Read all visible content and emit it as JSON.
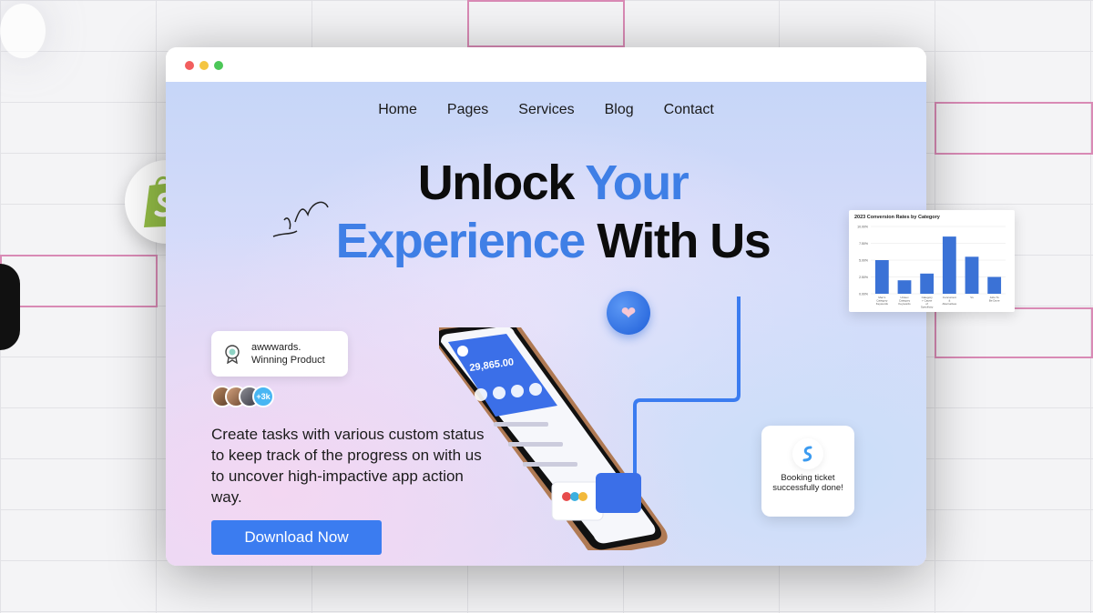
{
  "nav": {
    "items": [
      "Home",
      "Pages",
      "Services",
      "Blog",
      "Contact"
    ]
  },
  "hero": {
    "line1_dark": "Unlock",
    "line1_blue": "Your",
    "line2_blue": "Experience",
    "line2_dark": "With Us",
    "description": "Create tasks with various custom status to keep track of the progress on with us to uncover high-impactive app action way.",
    "cta_label": "Download Now"
  },
  "award": {
    "line1": "awwwards.",
    "line2": "Winning Product"
  },
  "avatars": {
    "count_label": "+3k"
  },
  "booking": {
    "text": "Booking ticket successfully done!"
  },
  "phone": {
    "balance": "29,865.00"
  },
  "colors": {
    "accent": "#3f7fe6",
    "button": "#3b7cf0",
    "shopify_green": "#95bf47"
  },
  "chart_data": {
    "type": "bar",
    "title": "2023 Conversion Rates by Category",
    "categories": [
      "Men's Category Keywords",
      "Unisex Category Keywords",
      "Category + Cause of Specificity",
      "Concurrent & Alternatives",
      "Vs",
      "Jobs To Be Done"
    ],
    "values": [
      5.0,
      2.0,
      3.0,
      8.5,
      5.5,
      2.5
    ],
    "ytick_labels": [
      "0.00%",
      "2.50%",
      "5.00%",
      "7.50%",
      "10.00%"
    ],
    "ylim": [
      0,
      10
    ]
  }
}
